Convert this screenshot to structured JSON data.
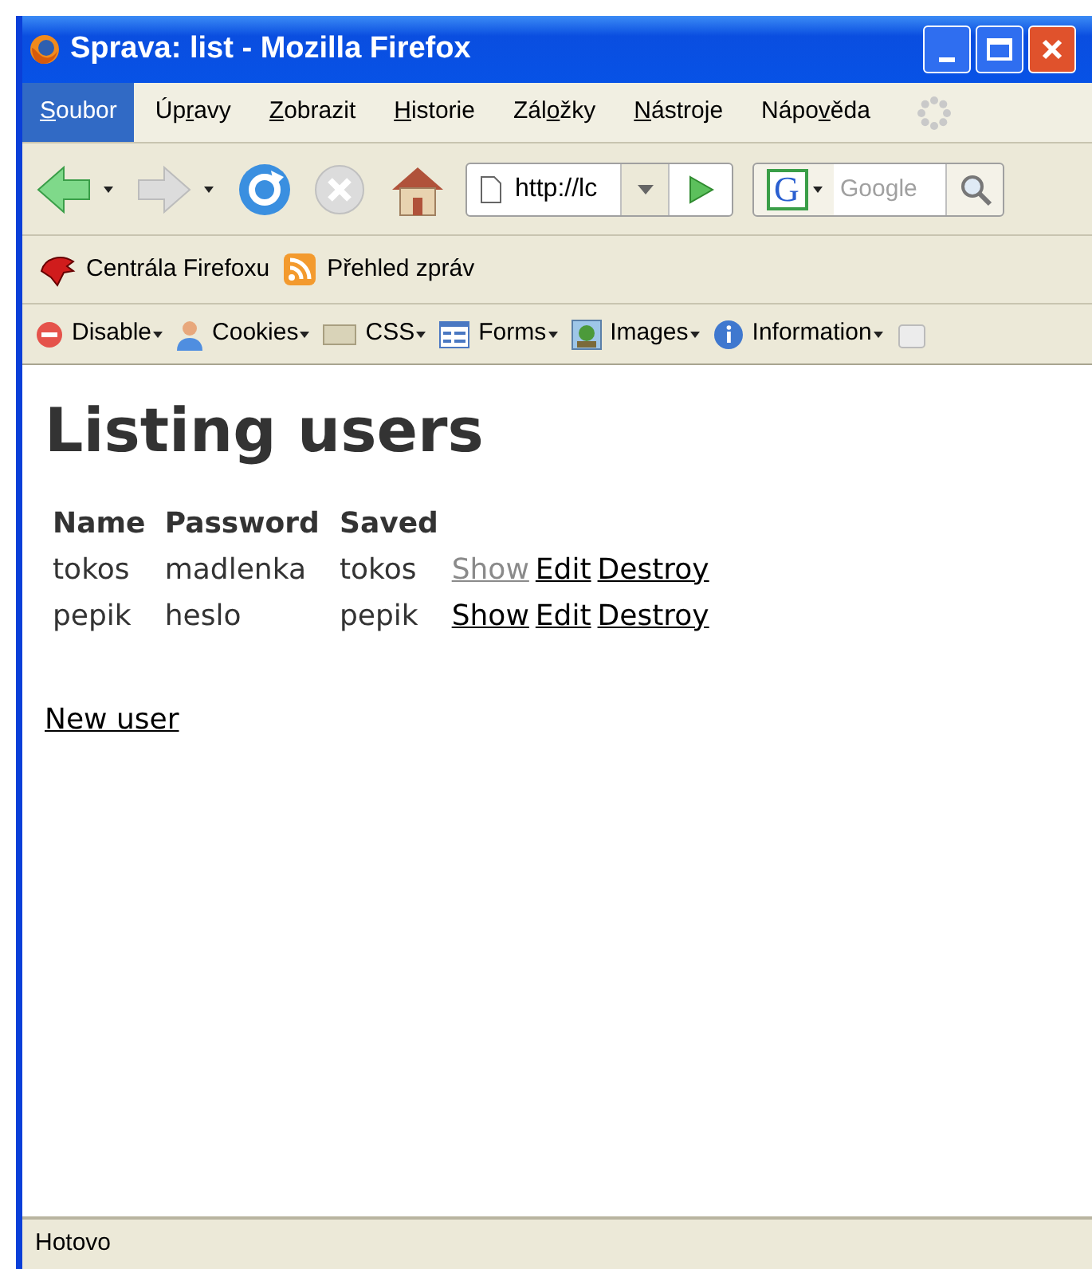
{
  "window": {
    "title": "Sprava: list - Mozilla Firefox"
  },
  "menu": [
    {
      "key": "S",
      "after": "oubor",
      "selected": true
    },
    {
      "before": "Úp",
      "key": "r",
      "after": "avy",
      "selected": false
    },
    {
      "key": "Z",
      "after": "obrazit",
      "selected": false
    },
    {
      "key": "H",
      "after": "istorie",
      "selected": false
    },
    {
      "before": "Zál",
      "key": "o",
      "after": "žky",
      "selected": false
    },
    {
      "key": "N",
      "after": "ástroje",
      "selected": false
    },
    {
      "before": "Nápo",
      "key": "v",
      "after": "ěda",
      "selected": false
    }
  ],
  "navigation": {
    "address": "http://lc",
    "search_engine": "G",
    "search_placeholder": "Google"
  },
  "bookmarks": [
    "Centrála Firefoxu",
    "Přehled zpráv"
  ],
  "developer_toolbar": [
    "Disable",
    "Cookies",
    "CSS",
    "Forms",
    "Images",
    "Information"
  ],
  "page": {
    "heading": "Listing users",
    "table": {
      "columns": [
        "Name",
        "Password",
        "Saved"
      ],
      "rows": [
        {
          "cells": [
            "tokos",
            "madlenka",
            "tokos"
          ],
          "links": [
            {
              "label": "Show",
              "visited": true
            },
            {
              "label": "Edit",
              "visited": false
            },
            {
              "label": "Destroy",
              "visited": false
            }
          ]
        },
        {
          "cells": [
            "pepik",
            "heslo",
            "pepik"
          ],
          "links": [
            {
              "label": "Show",
              "visited": false
            },
            {
              "label": "Edit",
              "visited": false
            },
            {
              "label": "Destroy",
              "visited": false
            }
          ]
        }
      ]
    },
    "new_link": "New user"
  },
  "status_bar": "Hotovo"
}
